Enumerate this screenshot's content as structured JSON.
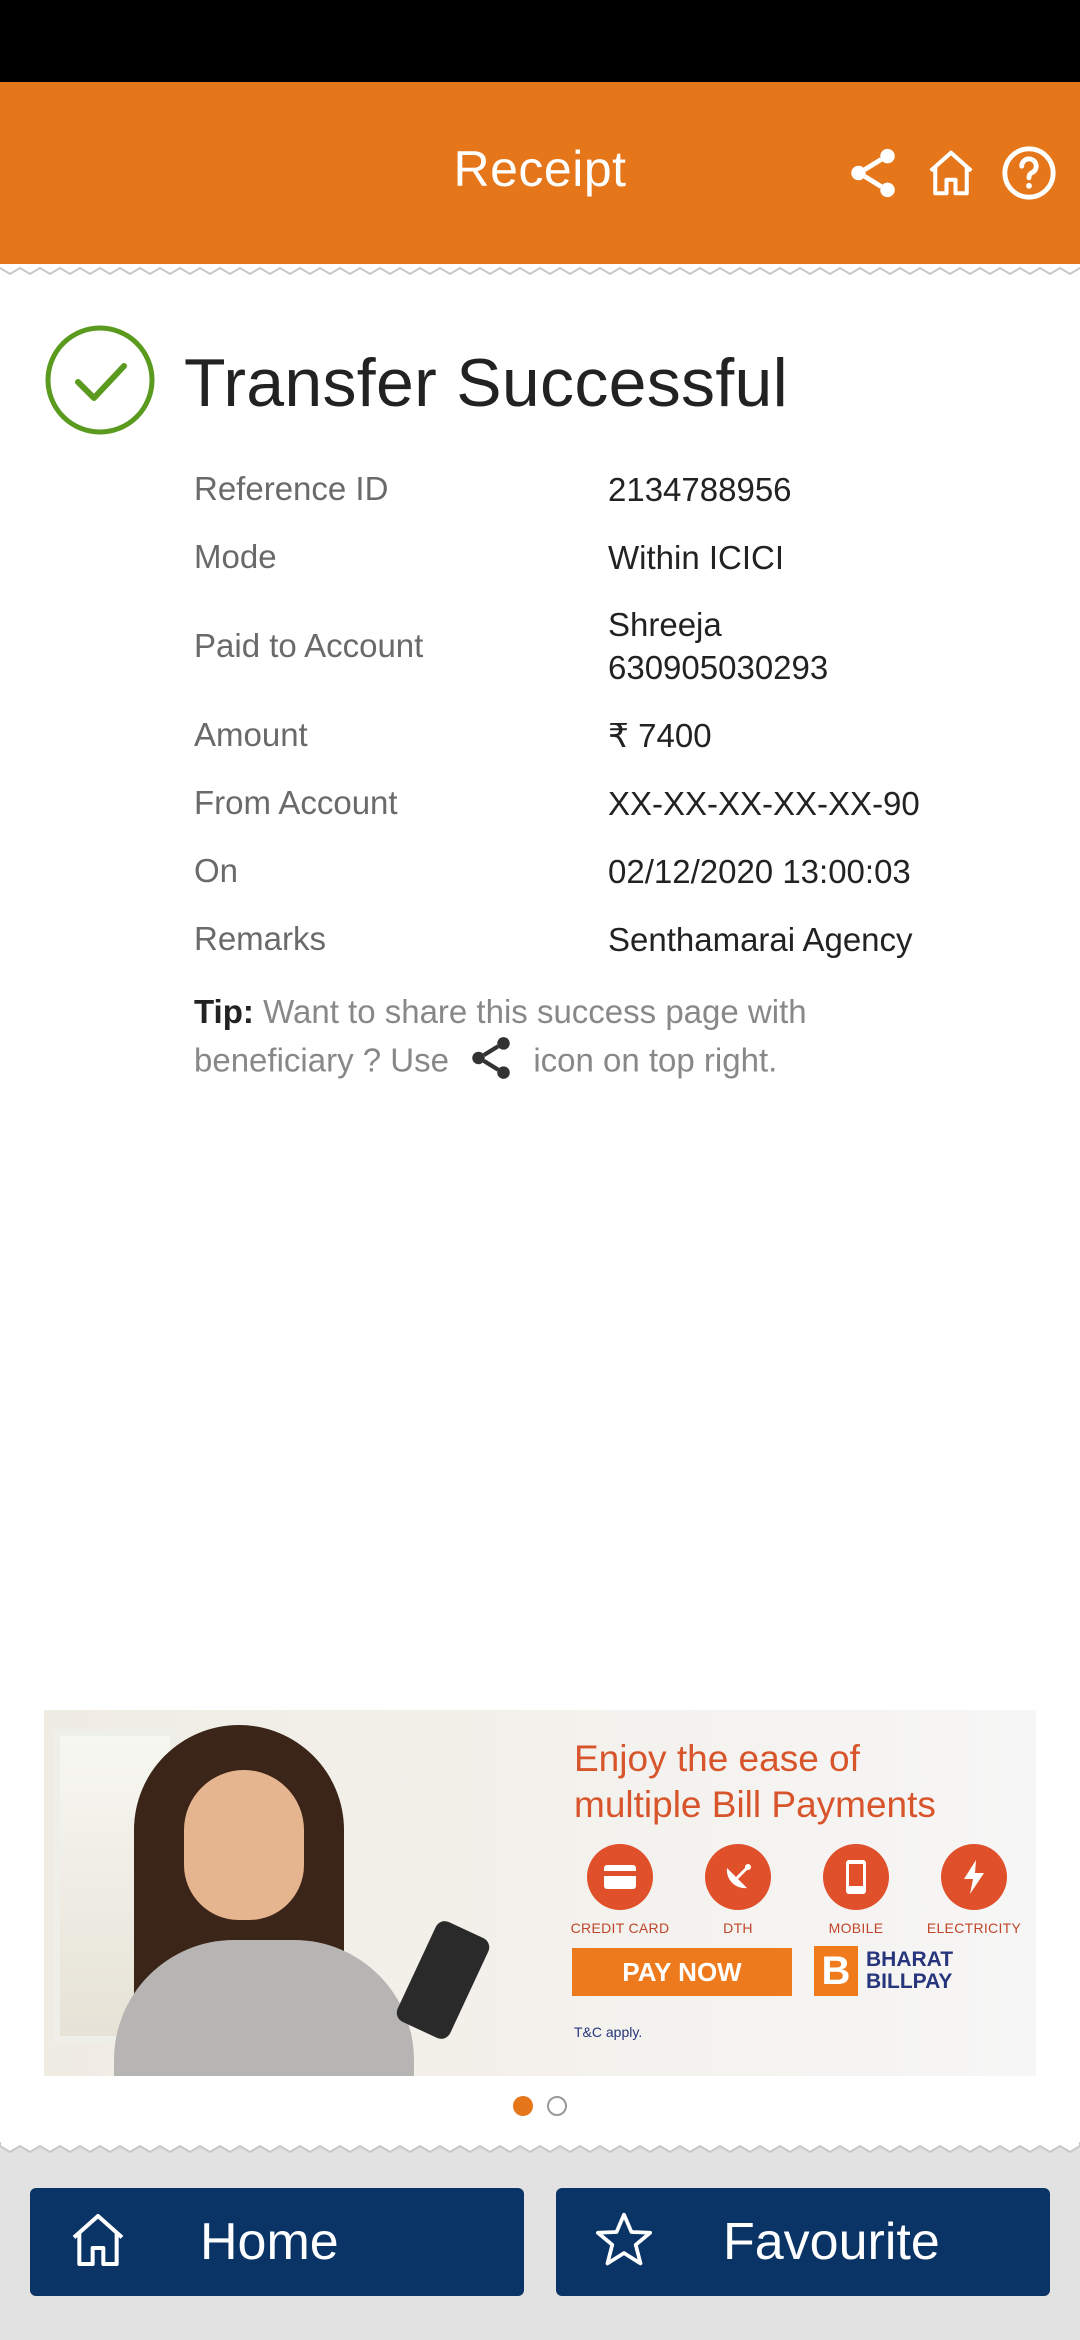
{
  "header": {
    "title": "Receipt",
    "accent_color": "#e5761a",
    "icons": [
      "share-icon",
      "home-icon",
      "help-icon"
    ]
  },
  "status": {
    "title": "Transfer Successful",
    "icon": "check-circle-icon",
    "icon_color": "#5a9a1e"
  },
  "details": [
    {
      "label": "Reference ID",
      "value": "2134788956"
    },
    {
      "label": "Mode",
      "value": "Within ICICI"
    },
    {
      "label": "Paid to Account",
      "value": "Shreeja",
      "value2": "630905030293"
    },
    {
      "label": "Amount",
      "value": "₹ 7400"
    },
    {
      "label": "From Account",
      "value": "XX-XX-XX-XX-XX-90"
    },
    {
      "label": "On",
      "value": "02/12/2020 13:00:03"
    },
    {
      "label": "Remarks",
      "value": "Senthamarai Agency"
    }
  ],
  "tip": {
    "prefix": "Tip:",
    "text_before": "Want to share this success page with beneficiary ? Use",
    "text_after": "icon on top right."
  },
  "banner": {
    "headline_line1": "Enjoy the ease of",
    "headline_line2": "multiple Bill Payments",
    "categories": [
      "CREDIT CARD",
      "DTH",
      "MOBILE",
      "ELECTRICITY"
    ],
    "cta": "PAY NOW",
    "brand_letter": "B",
    "brand_line1": "BHARAT",
    "brand_line2": "BILLPAY",
    "terms": "T&C apply."
  },
  "carousel": {
    "current": 1,
    "total": 2
  },
  "footer": {
    "home_label": "Home",
    "favourite_label": "Favourite",
    "button_color": "#0a3466"
  }
}
